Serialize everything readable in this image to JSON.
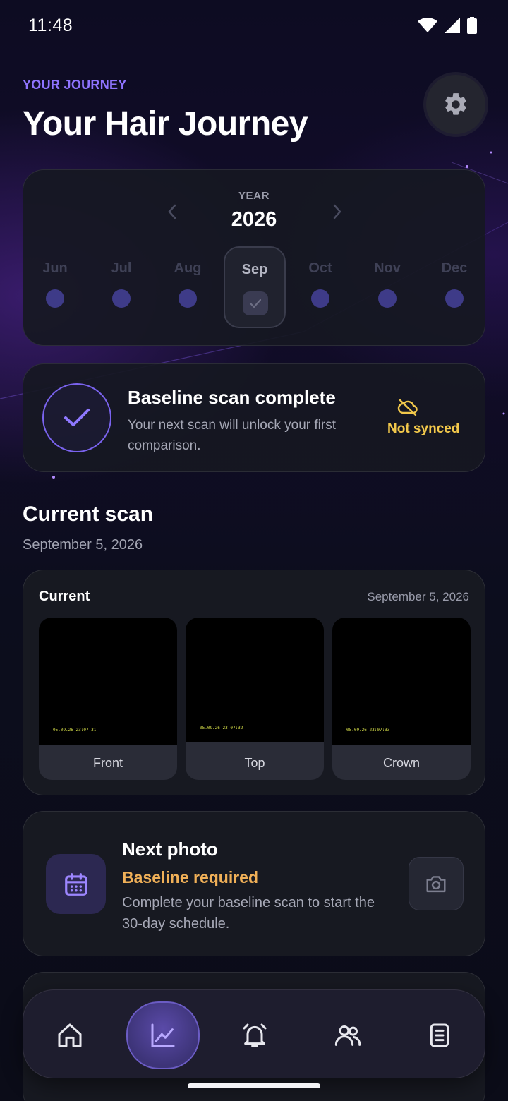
{
  "status_bar": {
    "time": "11:48"
  },
  "header": {
    "eyebrow": "YOUR JOURNEY",
    "title": "Your Hair Journey",
    "settings_icon": "gear-icon"
  },
  "year_selector": {
    "label": "YEAR",
    "year": "2026",
    "months": [
      {
        "label": "Jun",
        "selected": false
      },
      {
        "label": "Jul",
        "selected": false
      },
      {
        "label": "Aug",
        "selected": false
      },
      {
        "label": "Sep",
        "selected": true
      },
      {
        "label": "Oct",
        "selected": false
      },
      {
        "label": "Nov",
        "selected": false
      },
      {
        "label": "Dec",
        "selected": false
      }
    ]
  },
  "baseline_status": {
    "title": "Baseline scan complete",
    "subtitle": "Your next scan will unlock your first comparison.",
    "sync_label": "Not synced",
    "colors": {
      "accent": "#7a63ee",
      "warning": "#f2c84b"
    }
  },
  "current_scan": {
    "section_title": "Current scan",
    "section_date": "September 5, 2026",
    "card_title": "Current",
    "card_date": "September 5, 2026",
    "photos": [
      {
        "label": "Front",
        "stamp": "05.09.26 23:07:31"
      },
      {
        "label": "Top",
        "stamp": "05.09.26 23:07:32"
      },
      {
        "label": "Crown",
        "stamp": "05.09.26 23:07:33"
      }
    ]
  },
  "next_photo": {
    "title": "Next photo",
    "status": "Baseline required",
    "description": "Complete your baseline scan to start the 30-day schedule.",
    "status_color": "#f0b058"
  },
  "bottom_nav": {
    "items": [
      {
        "icon": "home-icon",
        "active": false
      },
      {
        "icon": "chart-icon",
        "active": true
      },
      {
        "icon": "alarm-icon",
        "active": false
      },
      {
        "icon": "people-icon",
        "active": false
      },
      {
        "icon": "document-icon",
        "active": false
      }
    ]
  }
}
